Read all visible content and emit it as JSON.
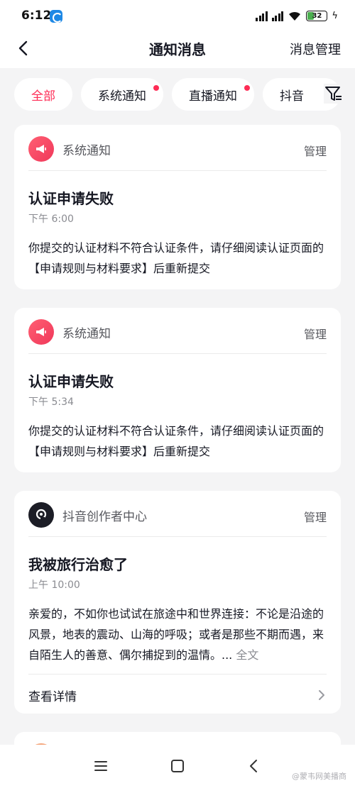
{
  "status_bar": {
    "time": "6:12",
    "battery": "32"
  },
  "header": {
    "title": "通知消息",
    "manage": "消息管理"
  },
  "tabs": [
    {
      "label": "全部",
      "active": true,
      "dot": false
    },
    {
      "label": "系统通知",
      "active": false,
      "dot": true
    },
    {
      "label": "直播通知",
      "active": false,
      "dot": true
    },
    {
      "label": "抖音",
      "active": false,
      "dot": false
    }
  ],
  "cards": [
    {
      "source": "系统通知",
      "manage": "管理",
      "title": "认证申请失败",
      "time": "下午 6:00",
      "body": "你提交的认证材料不符合认证条件，请仔细阅读认证页面的【申请规则与材料要求】后重新提交"
    },
    {
      "source": "系统通知",
      "manage": "管理",
      "title": "认证申请失败",
      "time": "下午 5:34",
      "body": "你提交的认证材料不符合认证条件，请仔细阅读认证页面的【申请规则与材料要求】后重新提交"
    },
    {
      "source": "抖音创作者中心",
      "manage": "管理",
      "title": "我被旅行治愈了",
      "time": "上午 10:00",
      "body": "亲爱的，不如你也试试在旅途中和世界连接：不论是沿途的风景，地表的震动、山海的呼吸；或者是那些不期而遇，来自陌生人的善意、偶尔捕捉到的温情。...",
      "more": "全文",
      "detail": "查看详情"
    }
  ],
  "watermark": "@蒙韦网美播商",
  "colors": {
    "accent": "#fe2c55",
    "background": "#f4f4f5"
  }
}
